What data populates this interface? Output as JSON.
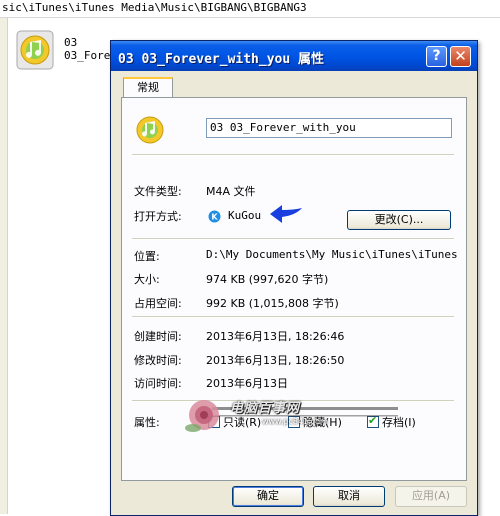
{
  "explorer": {
    "path": "sic\\iTunes\\iTunes Media\\Music\\BIGBANG\\BIGBANG3",
    "file_line1": "03",
    "file_line2": "03_Forev"
  },
  "dialog": {
    "title": "03 03_Forever_with_you 属性",
    "help_glyph": "?",
    "close_glyph": "✕",
    "tab_label": "常规",
    "file_name": "03 03_Forever_with_you",
    "file_type_label": "文件类型:",
    "file_type_value": "M4A 文件",
    "open_with_label": "打开方式:",
    "open_with_app": "KuGou",
    "change_button": "更改(C)...",
    "location_label": "位置:",
    "location_value": "D:\\My Documents\\My Music\\iTunes\\iTunes Me",
    "size_label": "大小:",
    "size_value": "974 KB (997,620 字节)",
    "disk_size_label": "占用空间:",
    "disk_size_value": "992 KB (1,015,808 字节)",
    "created_label": "创建时间:",
    "created_value": "2013年6月13日, 18:26:46",
    "modified_label": "修改时间:",
    "modified_value": "2013年6月13日, 18:26:50",
    "accessed_label": "访问时间:",
    "accessed_value": "2013年6月13日",
    "attributes_label": "属性:",
    "readonly_label": "只读(R)",
    "hidden_label": "隐藏(H)",
    "archive_label": "存档(I)",
    "readonly_checked": false,
    "hidden_checked": false,
    "archive_checked": true,
    "ok_button": "确定",
    "cancel_button": "取消",
    "apply_button": "应用(A)"
  },
  "watermark": {
    "text": "电脑百事网",
    "url": "www.pc841.com"
  },
  "colors": {
    "titlebar": "#0055e5",
    "dialog_bg": "#ece9d8",
    "arrow": "#1a3fe0"
  }
}
